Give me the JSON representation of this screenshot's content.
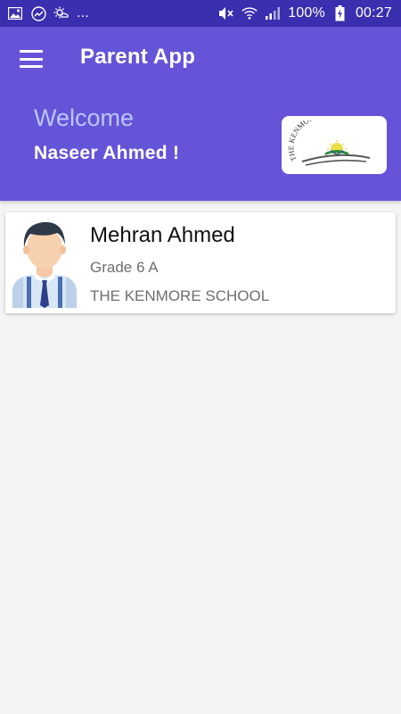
{
  "status_bar": {
    "notification_more": "...",
    "battery": "100%",
    "time": "00:27"
  },
  "app_bar": {
    "title": "Parent App",
    "menu_icon": "hamburger-menu-icon"
  },
  "header": {
    "welcome": "Welcome",
    "parent_name": "Naseer Ahmed !",
    "logo_text": "THE KENMORE SCHOOL"
  },
  "students": [
    {
      "name": "Mehran Ahmed",
      "grade": "Grade 6 A",
      "school": "THE KENMORE SCHOOL"
    }
  ],
  "colors": {
    "status_bar": "#3a2fae",
    "header": "#6554d8",
    "welcome_text": "#b9c6ff",
    "background": "#f3f4f6"
  }
}
